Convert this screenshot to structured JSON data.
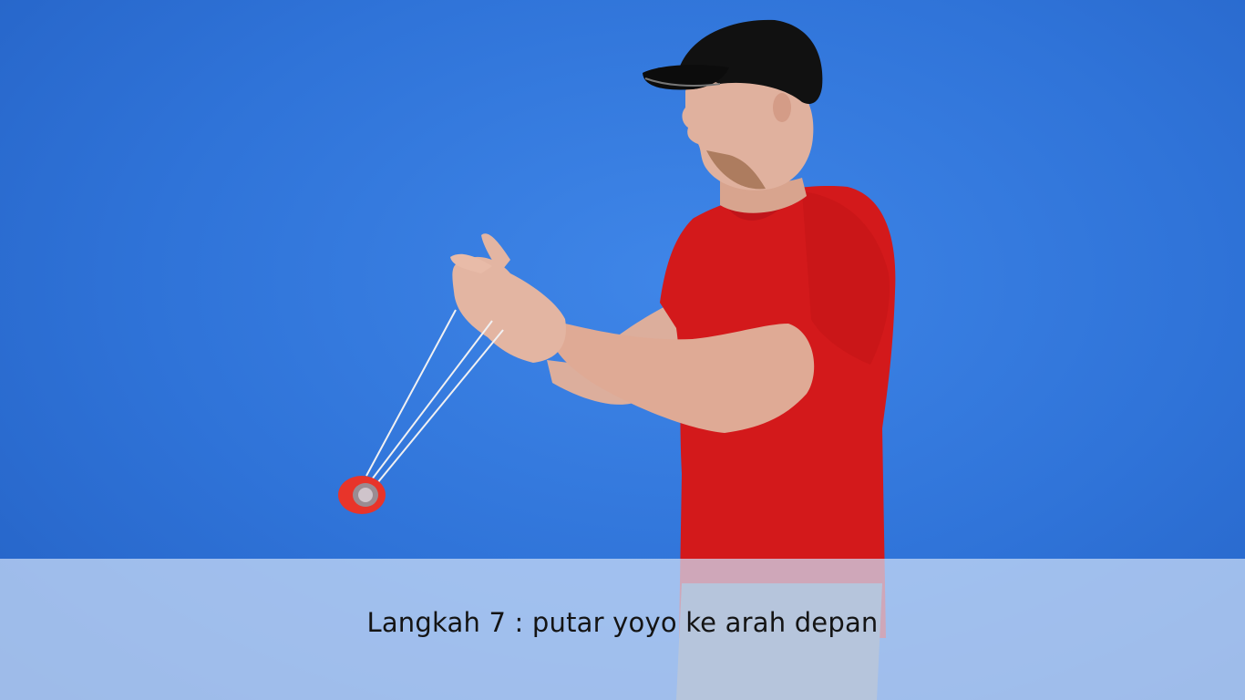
{
  "video": {
    "background_color": "#3b7fe3",
    "subtitle": "Langkah 7 : putar yoyo ke arah depan",
    "subtitle_bar_color": "#cddef6",
    "subject": {
      "shirt_color": "#d5191a",
      "cap_color": "#111111",
      "yoyo_color": "#e8342a"
    }
  }
}
